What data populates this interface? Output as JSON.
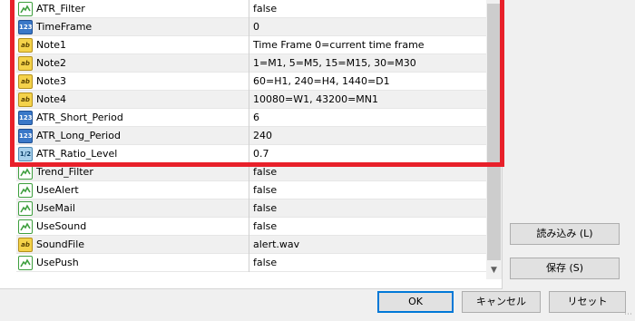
{
  "parameters": [
    {
      "name": "ATR_Filter",
      "value": "false",
      "icon": "bool-icon"
    },
    {
      "name": "TimeFrame",
      "value": "0",
      "icon": "int-icon"
    },
    {
      "name": "Note1",
      "value": "Time Frame 0=current time frame",
      "icon": "string-icon"
    },
    {
      "name": "Note2",
      "value": "1=M1, 5=M5, 15=M15, 30=M30",
      "icon": "string-icon"
    },
    {
      "name": "Note3",
      "value": "60=H1, 240=H4, 1440=D1",
      "icon": "string-icon"
    },
    {
      "name": "Note4",
      "value": "10080=W1, 43200=MN1",
      "icon": "string-icon"
    },
    {
      "name": "ATR_Short_Period",
      "value": "6",
      "icon": "int-icon"
    },
    {
      "name": "ATR_Long_Period",
      "value": "240",
      "icon": "int-icon"
    },
    {
      "name": "ATR_Ratio_Level",
      "value": "0.7",
      "icon": "double-icon"
    },
    {
      "name": "Trend_Filter",
      "value": "false",
      "icon": "bool-icon"
    },
    {
      "name": "UseAlert",
      "value": "false",
      "icon": "bool-icon"
    },
    {
      "name": "UseMail",
      "value": "false",
      "icon": "bool-icon"
    },
    {
      "name": "UseSound",
      "value": "false",
      "icon": "bool-icon"
    },
    {
      "name": "SoundFile",
      "value": "alert.wav",
      "icon": "string-icon"
    },
    {
      "name": "UsePush",
      "value": "false",
      "icon": "bool-icon"
    }
  ],
  "icons": {
    "int_text": "123",
    "string_text": "ab",
    "double_text": "1/2"
  },
  "buttons": {
    "load": "読み込み (L)",
    "save": "保存 (S)",
    "ok": "OK",
    "cancel": "キャンセル",
    "reset": "リセット"
  },
  "colors": {
    "highlight": "#e8202a",
    "bool_icon": "#3f9f3f",
    "int_icon": "#3a78c8",
    "string_icon": "#f4d24a",
    "double_icon": "#a7d0ec"
  }
}
